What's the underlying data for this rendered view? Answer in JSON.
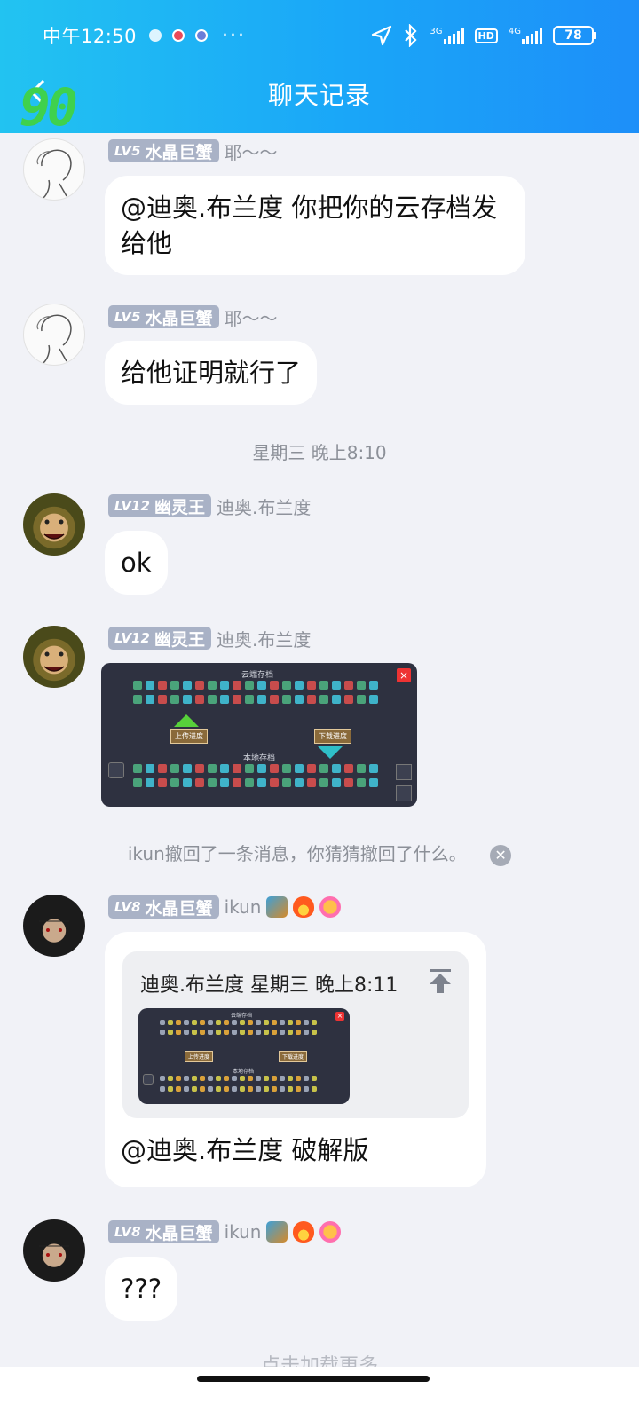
{
  "status_bar": {
    "time": "中午12:50",
    "more": "···",
    "net3g": "3G",
    "net4g": "4G",
    "hd": "HD",
    "battery": "78"
  },
  "header": {
    "title": "聊天记录",
    "watermark": "90"
  },
  "messages": [
    {
      "level": "LV5",
      "title": "水晶巨蟹",
      "nickname": "耶～～",
      "text_line1": "@迪奥.布兰度 你把你的云存档发",
      "text_line2": "给他"
    },
    {
      "level": "LV5",
      "title": "水晶巨蟹",
      "nickname": "耶～～",
      "text": "给他证明就行了"
    },
    {
      "level": "LV12",
      "title": "幽灵王",
      "nickname": "迪奥.布兰度",
      "text": "ok"
    },
    {
      "level": "LV12",
      "title": "幽灵王",
      "nickname": "迪奥.布兰度",
      "image": {
        "top_label": "云端存档",
        "upload_label": "上传进度",
        "download_label": "下载进度",
        "bottom_label": "本地存档"
      }
    },
    {
      "level": "LV8",
      "title": "水晶巨蟹",
      "nickname": "ikun",
      "reply_header": "迪奥.布兰度 星期三 晚上8:11",
      "text": "@迪奥.布兰度 破解版"
    },
    {
      "level": "LV8",
      "title": "水晶巨蟹",
      "nickname": "ikun",
      "text": "???"
    }
  ],
  "timestamp": "星期三 晚上8:10",
  "recall_notice": "ikun撤回了一条消息，你猜猜撤回了什么。",
  "load_more": "点击加载更多",
  "colors": {
    "header_start": "#22c3f1",
    "header_end": "#1d8ff9",
    "level_badge": "#a9b2c6",
    "background": "#f1f2f7"
  }
}
